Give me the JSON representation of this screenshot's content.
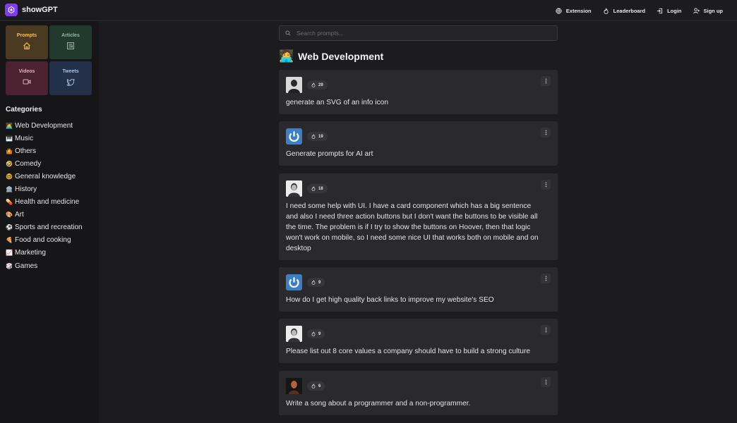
{
  "header": {
    "app_name": "showGPT",
    "nav": [
      {
        "label": "Extension",
        "icon": "globe-icon"
      },
      {
        "label": "Leaderboard",
        "icon": "flame-icon"
      },
      {
        "label": "Login",
        "icon": "login-icon"
      },
      {
        "label": "Sign up",
        "icon": "user-plus-icon"
      }
    ]
  },
  "sidebar": {
    "tiles": [
      {
        "label": "Prompts",
        "icon": "home-icon",
        "color": "#f3c34a"
      },
      {
        "label": "Articles",
        "icon": "newspaper-icon",
        "color": "#9ab7a6"
      },
      {
        "label": "Videos",
        "icon": "video-icon",
        "color": "#e3b1bf"
      },
      {
        "label": "Tweets",
        "icon": "twitter-icon",
        "color": "#a9c1e0"
      }
    ],
    "categories_title": "Categories",
    "categories": [
      {
        "emoji": "🧑‍💻",
        "label": "Web Development"
      },
      {
        "emoji": "🎹",
        "label": "Music"
      },
      {
        "emoji": "🤷",
        "label": "Others"
      },
      {
        "emoji": "🤣",
        "label": "Comedy"
      },
      {
        "emoji": "🤓",
        "label": "General knowledge"
      },
      {
        "emoji": "🏛️",
        "label": "History"
      },
      {
        "emoji": "💊",
        "label": "Health and medicine"
      },
      {
        "emoji": "🎨",
        "label": "Art"
      },
      {
        "emoji": "⚽",
        "label": "Sports and recreation"
      },
      {
        "emoji": "🍕",
        "label": "Food and cooking"
      },
      {
        "emoji": "📈",
        "label": "Marketing"
      },
      {
        "emoji": "🎲",
        "label": "Games"
      }
    ]
  },
  "main": {
    "search_placeholder": "Search prompts...",
    "page_emoji": "🧑‍💻",
    "page_title": "Web Development",
    "prompts": [
      {
        "likes": "29",
        "text": "generate an SVG of an info icon",
        "avatar": "photo"
      },
      {
        "likes": "19",
        "text": "Generate prompts for AI art",
        "avatar": "power"
      },
      {
        "likes": "18",
        "text": "I need some help with UI. I have a card component which has a big sentence and also I need three action buttons but I don't want the buttons to be visible all the time. The problem is if I try to show the buttons on Hoover, then that logic won't work on mobile, so I need some nice UI that works both on mobile and on desktop",
        "avatar": "photo"
      },
      {
        "likes": "9",
        "text": "How do I get high quality back links to improve my website's SEO",
        "avatar": "power"
      },
      {
        "likes": "9",
        "text": "Please list out 8 core values a company should have to build a strong culture",
        "avatar": "photo"
      },
      {
        "likes": "6",
        "text": "Write a song about a programmer and a non-programmer.",
        "avatar": "photo"
      }
    ]
  }
}
